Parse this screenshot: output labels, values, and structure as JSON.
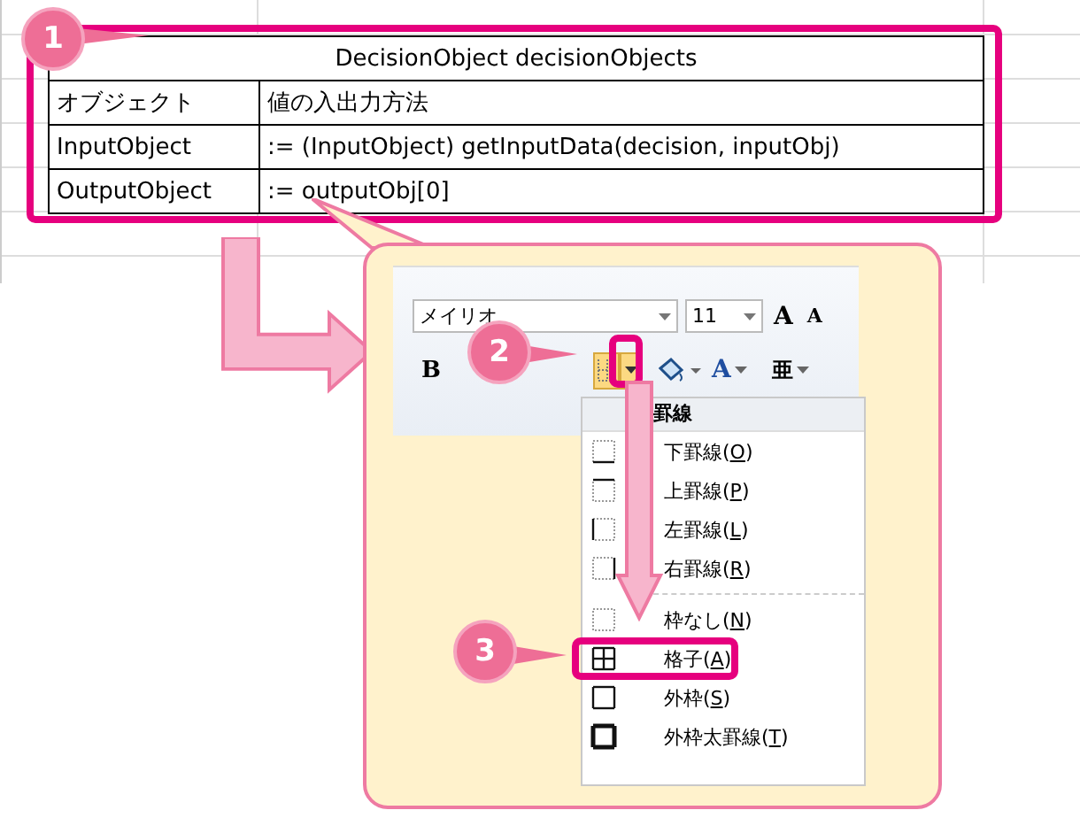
{
  "table": {
    "title": "DecisionObject decisionObjects",
    "rows": [
      [
        "オブジェクト",
        "値の入出力方法"
      ],
      [
        "InputObject",
        ":= (InputObject) getInputData(decision, inputObj)"
      ],
      [
        "OutputObject",
        ":= outputObj[0]"
      ]
    ]
  },
  "badges": [
    "1",
    "2",
    "3"
  ],
  "ribbon": {
    "font_name": "メイリオ",
    "font_size": "11",
    "grow_font": "A",
    "shrink_font": "A",
    "bold": "B",
    "font_color": "A",
    "phonetic": "亜"
  },
  "menu": {
    "header": "罫線",
    "items": [
      {
        "kind": "bottom",
        "label": "下罫線(O)",
        "selected": false
      },
      {
        "kind": "top",
        "label": "上罫線(P)",
        "selected": false
      },
      {
        "kind": "left",
        "label": "左罫線(L)",
        "selected": false
      },
      {
        "kind": "right",
        "label": "右罫線(R)",
        "selected": false
      },
      {
        "kind": "none",
        "label": "枠なし(N)",
        "selected": false
      },
      {
        "kind": "all",
        "label": "格子(A)",
        "selected": true
      },
      {
        "kind": "outside",
        "label": "外枠(S)",
        "selected": false
      },
      {
        "kind": "thick",
        "label": "外枠太罫線(T)",
        "selected": false
      }
    ]
  }
}
